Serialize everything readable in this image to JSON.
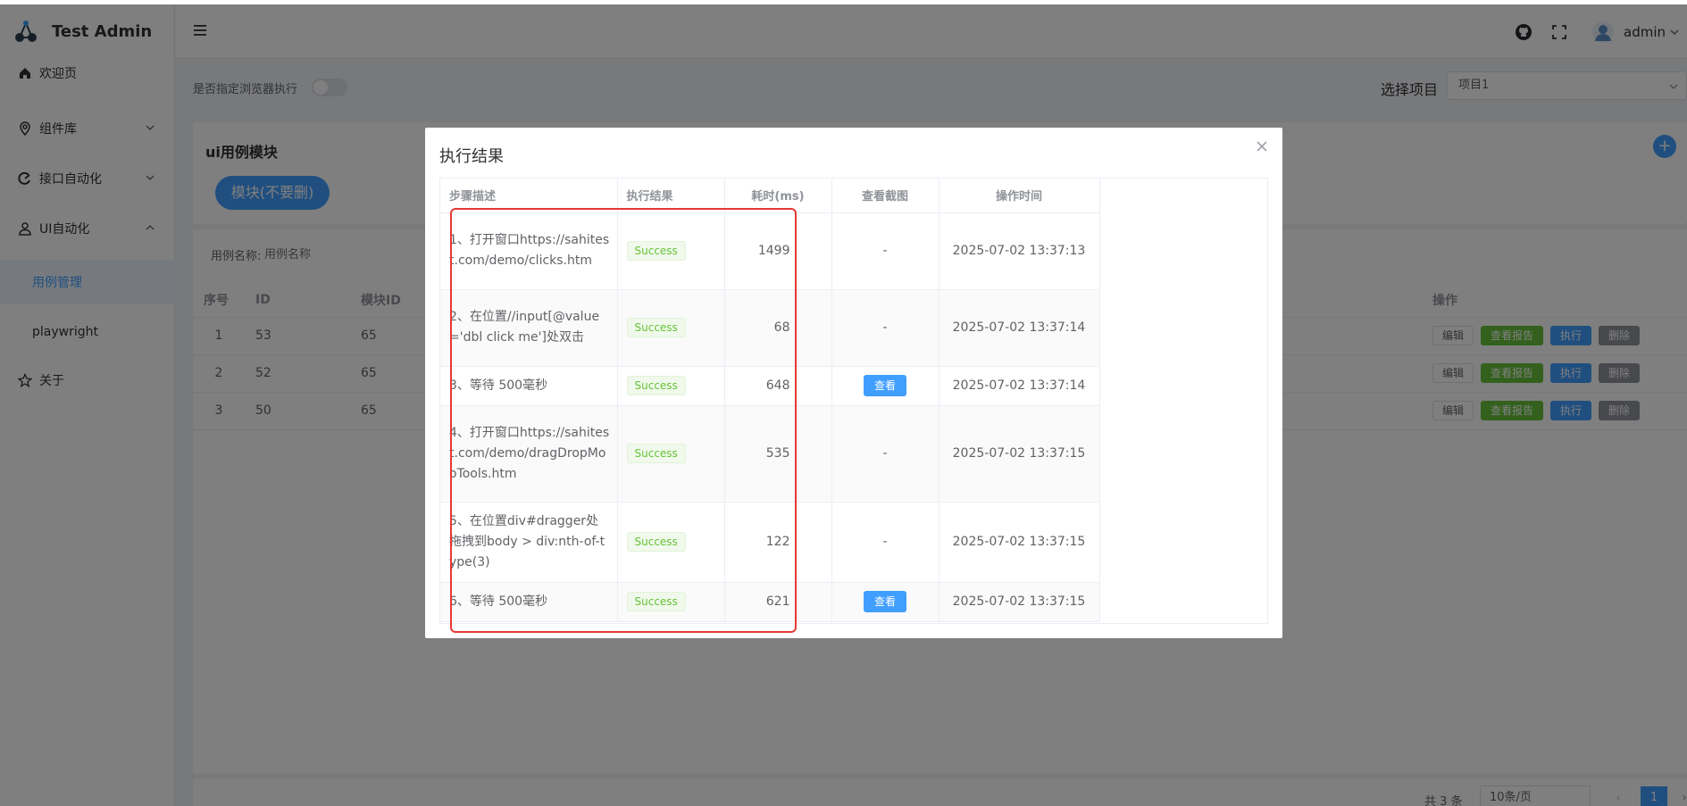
{
  "app": {
    "title": "Test Admin"
  },
  "sidebar": {
    "items": [
      {
        "label": "欢迎页"
      },
      {
        "label": "组件库"
      },
      {
        "label": "接口自动化"
      },
      {
        "label": "UI自动化"
      },
      {
        "label": "用例管理"
      },
      {
        "label": "playwright"
      },
      {
        "label": "关于"
      }
    ]
  },
  "header": {
    "user": "admin"
  },
  "topbar": {
    "browser_label": "是否指定浏览器执行",
    "project_label": "选择项目",
    "project_value": "项目1"
  },
  "module_card": {
    "title": "ui用例模块",
    "module_button": "模块(不要删)",
    "add_icon": "+"
  },
  "search": {
    "label": "用例名称:",
    "placeholder": "用例名称"
  },
  "case_table": {
    "headers": {
      "index": "序号",
      "id": "ID",
      "module_id": "模块ID",
      "ops": "操作"
    },
    "rows": [
      {
        "index": "1",
        "id": "53",
        "module_id": "65"
      },
      {
        "index": "2",
        "id": "52",
        "module_id": "65"
      },
      {
        "index": "3",
        "id": "50",
        "module_id": "65"
      }
    ],
    "op_labels": {
      "edit": "编辑",
      "report": "查看报告",
      "run": "执行",
      "delete": "删除"
    }
  },
  "pagination": {
    "total": "共 3 条",
    "page_size": "10条/页",
    "current": "1",
    "prev": "‹",
    "next": "›"
  },
  "dialog": {
    "title": "执行结果",
    "headers": {
      "desc": "步骤描述",
      "result": "执行结果",
      "duration": "耗时(ms)",
      "screenshot": "查看截图",
      "time": "操作时间"
    },
    "rows": [
      {
        "desc": "1、打开窗口https://sahitest.com/demo/clicks.htm",
        "result": "Success",
        "duration": "1499",
        "screenshot": "-",
        "time": "2025-07-02 13:37:13"
      },
      {
        "desc": "2、在位置//input[@value='dbl click me']处双击",
        "result": "Success",
        "duration": "68",
        "screenshot": "-",
        "time": "2025-07-02 13:37:14"
      },
      {
        "desc": "3、等待 500毫秒",
        "result": "Success",
        "duration": "648",
        "screenshot": "查看",
        "time": "2025-07-02 13:37:14"
      },
      {
        "desc": "4、打开窗口https://sahitest.com/demo/dragDropMooTools.htm",
        "result": "Success",
        "duration": "535",
        "screenshot": "-",
        "time": "2025-07-02 13:37:15"
      },
      {
        "desc": "5、在位置div#dragger处拖拽到body > div:nth-of-type(3)",
        "result": "Success",
        "duration": "122",
        "screenshot": "-",
        "time": "2025-07-02 13:37:15"
      },
      {
        "desc": "6、等待 500毫秒",
        "result": "Success",
        "duration": "621",
        "screenshot": "查看",
        "time": "2025-07-02 13:37:15"
      }
    ]
  },
  "colors": {
    "primary": "#409eff",
    "success": "#67c23a",
    "annotation": "#e53935"
  }
}
